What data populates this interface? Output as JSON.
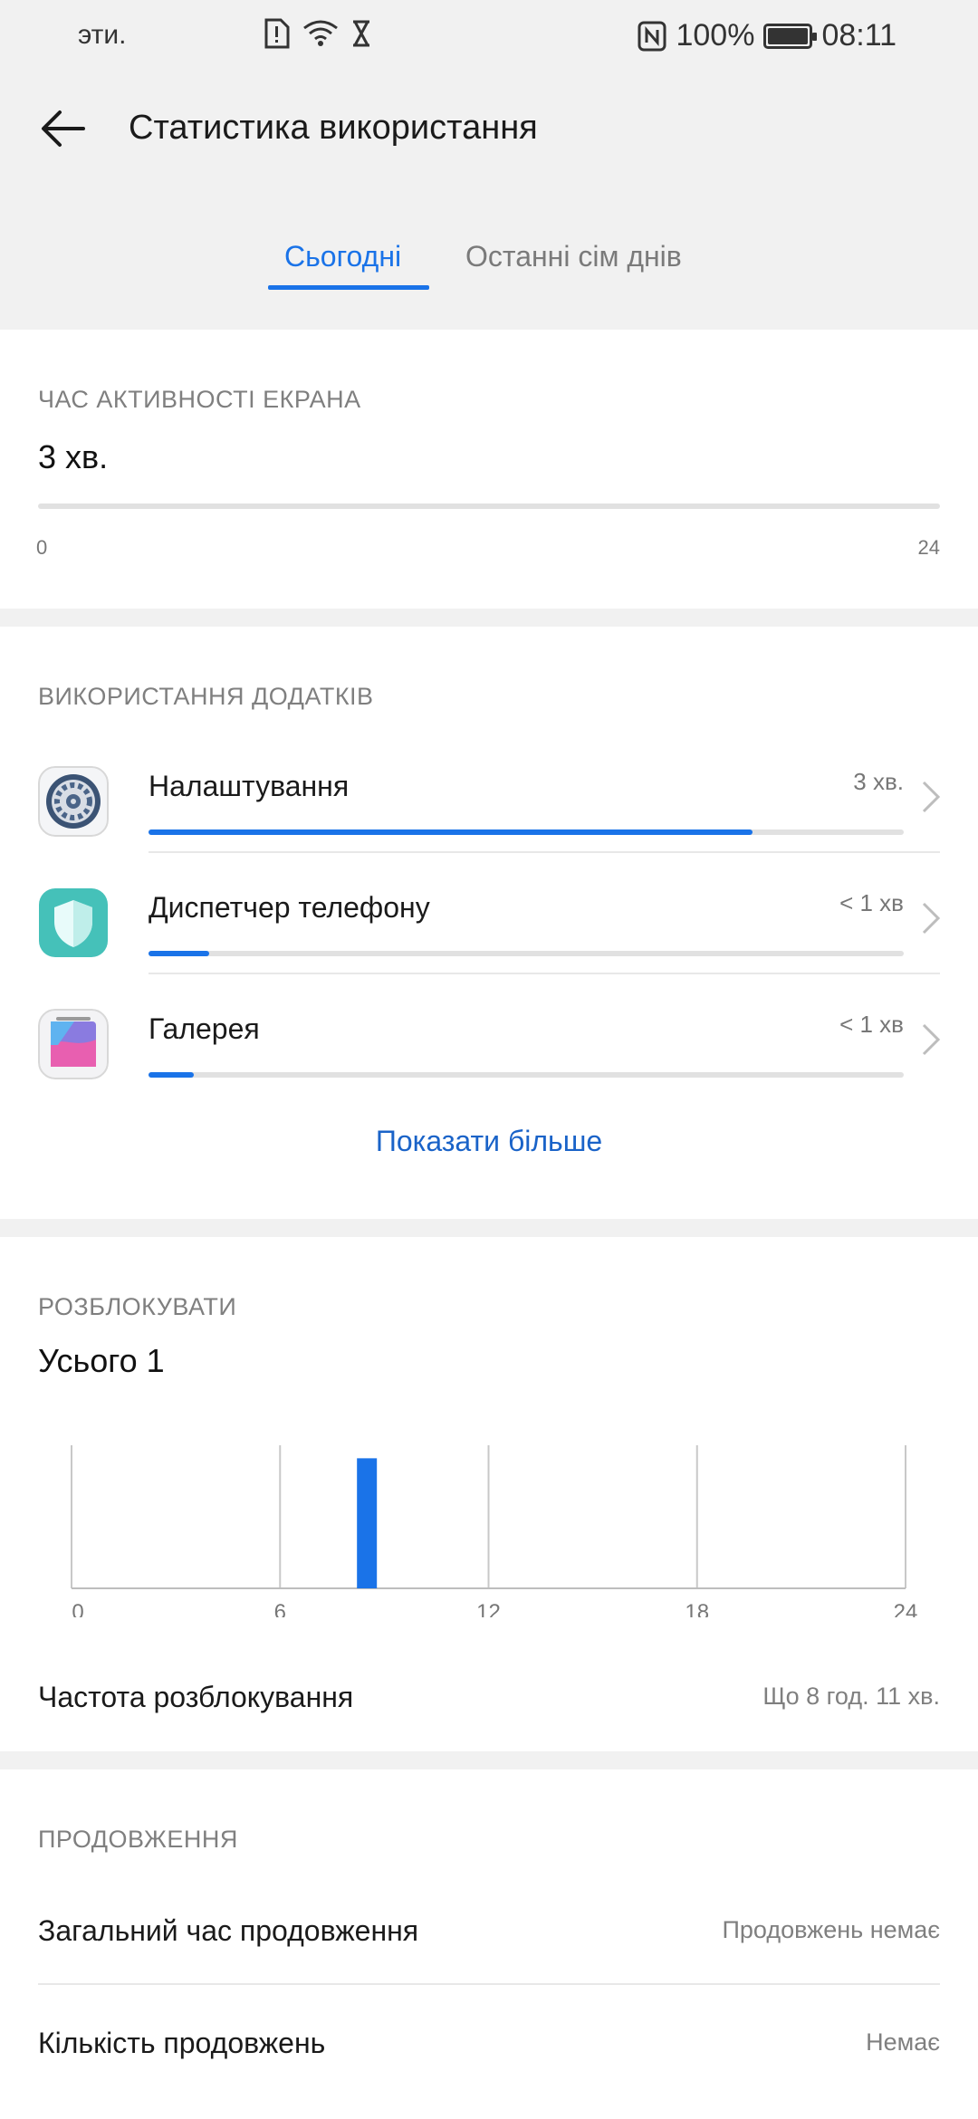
{
  "status_bar": {
    "left_text": "эти.",
    "battery_percent": "100%",
    "time": "08:11"
  },
  "header": {
    "title": "Статистика використання"
  },
  "tabs": [
    {
      "label": "Сьогодні",
      "selected": true
    },
    {
      "label": "Останні сім днів",
      "selected": false
    }
  ],
  "screen_time": {
    "label": "ЧАС АКТИВНОСТІ ЕКРАНА",
    "value": "3 хв.",
    "axis_min": "0",
    "axis_max": "24",
    "fraction": 0.0
  },
  "app_usage": {
    "label": "ВИКОРИСТАННЯ ДОДАТКІВ",
    "apps": [
      {
        "name": "Налаштування",
        "time": "3 хв.",
        "fraction": 0.8,
        "icon": "settings-gear-icon"
      },
      {
        "name": "Диспетчер телефону",
        "time": "< 1 хв",
        "fraction": 0.08,
        "icon": "shield-icon"
      },
      {
        "name": "Галерея",
        "time": "< 1 хв",
        "fraction": 0.06,
        "icon": "gallery-icon"
      }
    ],
    "show_more": "Показати більше"
  },
  "unlocks": {
    "label": "РОЗБЛОКУВАТИ",
    "total": "Усього 1",
    "frequency_label": "Частота розблокування",
    "frequency_value": "Що 8 год. 11 хв."
  },
  "chart_data": {
    "type": "bar",
    "x": [
      8
    ],
    "values": [
      1
    ],
    "xlim": [
      0,
      24
    ],
    "ylim": [
      0,
      1.1
    ],
    "xticks": [
      "0",
      "6",
      "12",
      "18",
      "24"
    ],
    "grid": true,
    "colors": {
      "bar": "#1a73e8"
    }
  },
  "extensions": {
    "label": "ПРОДОВЖЕННЯ",
    "rows": [
      {
        "label": "Загальний час продовження",
        "value": "Продовжень немає"
      },
      {
        "label": "Кількість продовжень",
        "value": "Немає"
      }
    ]
  },
  "colors": {
    "accent": "#1a73e8",
    "background": "#f1f1f1",
    "card": "#ffffff"
  }
}
